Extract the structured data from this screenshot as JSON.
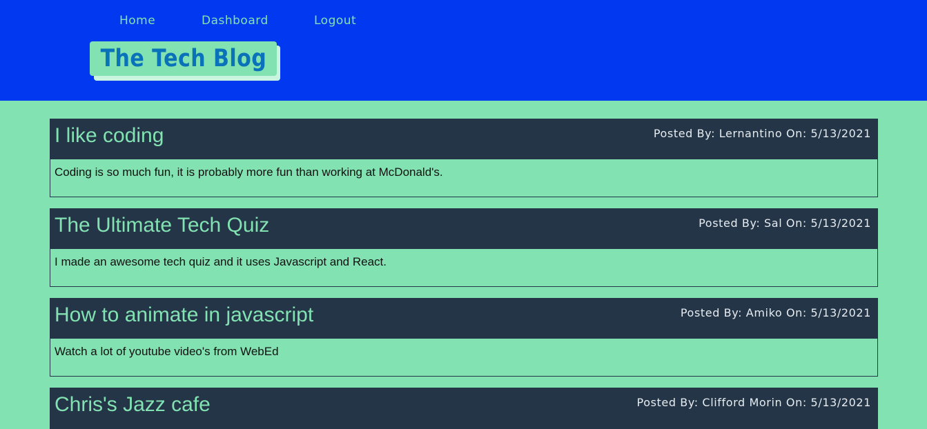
{
  "nav": {
    "home": "Home",
    "dashboard": "Dashboard",
    "logout": "Logout"
  },
  "site": {
    "title": "The Tech Blog"
  },
  "posts": [
    {
      "title": "I like coding",
      "meta": "Posted By: Lernantino On: 5/13/2021",
      "body": "Coding is so much fun, it is probably more fun than working at McDonald's."
    },
    {
      "title": "The Ultimate Tech Quiz",
      "meta": "Posted By: Sal On: 5/13/2021",
      "body": "I made an awesome tech quiz and it uses Javascript and React."
    },
    {
      "title": "How to animate in javascript",
      "meta": "Posted By: Amiko On: 5/13/2021",
      "body": "Watch a lot of youtube video's from WebEd"
    },
    {
      "title": "Chris's Jazz cafe",
      "meta": "Posted By: Clifford Morin On: 5/13/2021",
      "body": ""
    }
  ],
  "colors": {
    "header_bg": "#0238f0",
    "page_bg": "#82e2b2",
    "post_head_bg": "#243547",
    "logo_text": "#0a72b8"
  }
}
